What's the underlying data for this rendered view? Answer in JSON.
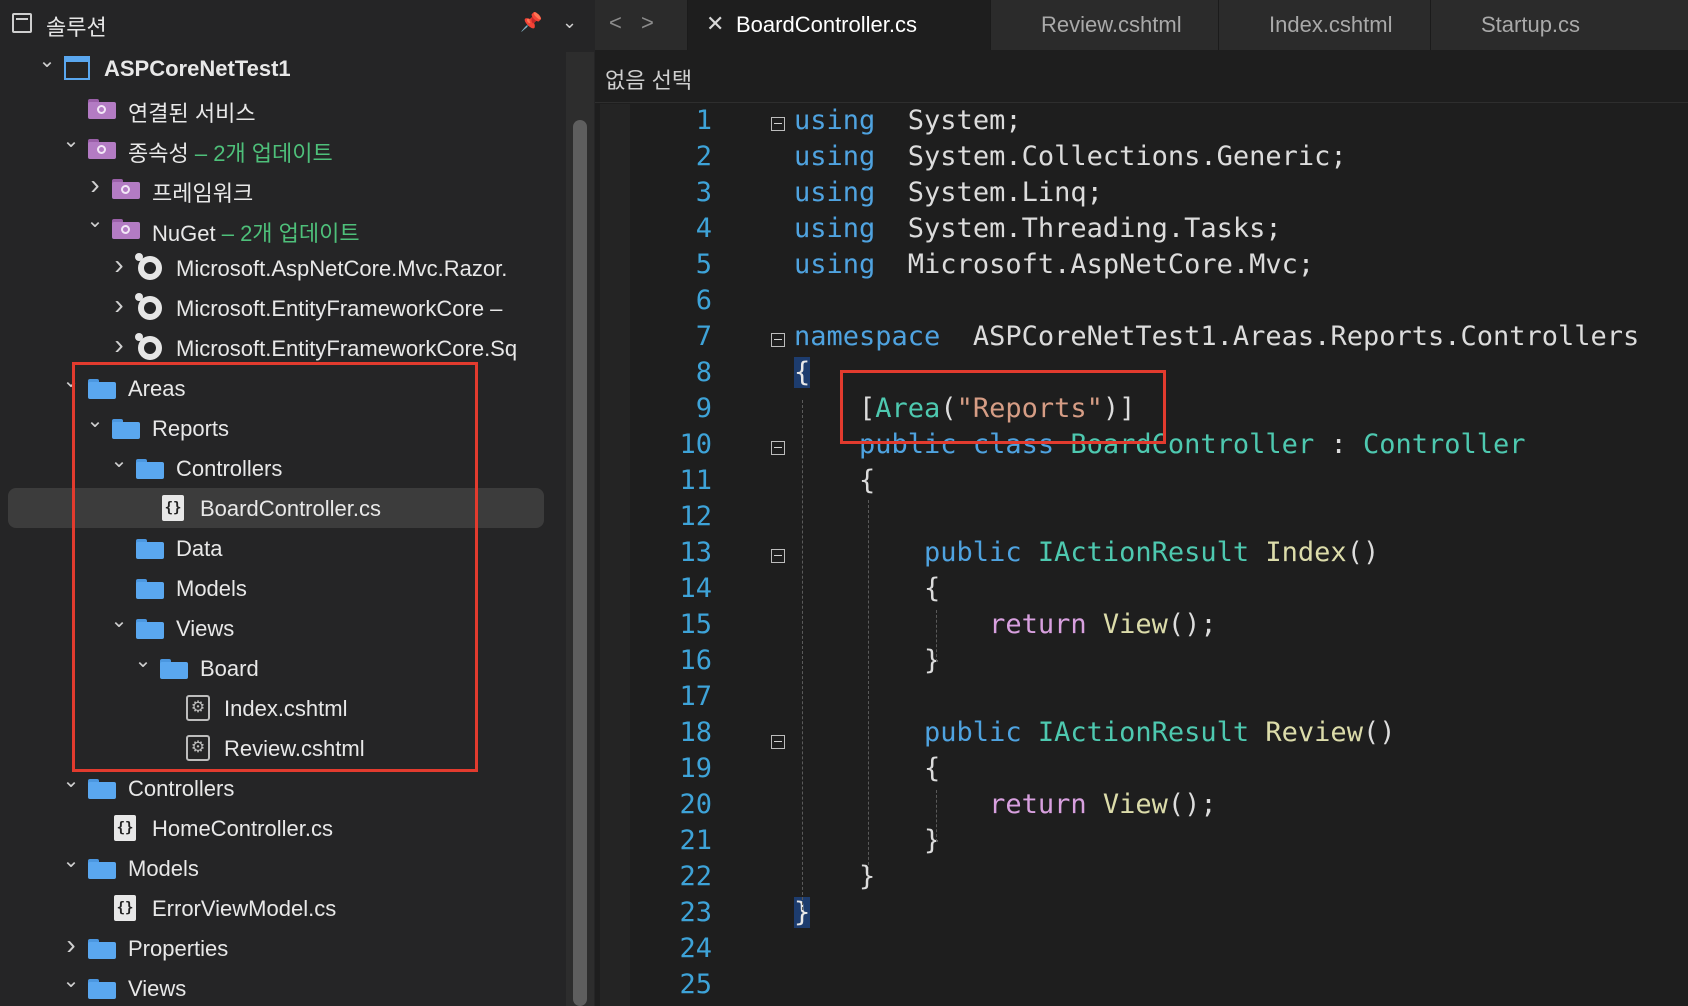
{
  "sidebar": {
    "title": "솔루션",
    "tree": [
      {
        "label": "ASPCoreNetTest1",
        "icon": "project-icon",
        "chevron": "down"
      },
      {
        "label": "연결된 서비스",
        "icon": "connected-services-icon",
        "chevron": ""
      },
      {
        "label": "종속성",
        "note": "– 2개 업데이트",
        "icon": "dependencies-icon",
        "chevron": "down"
      },
      {
        "label": "프레임워크",
        "icon": "framework-icon",
        "chevron": "right"
      },
      {
        "label": "NuGet",
        "note": "– 2개 업데이트",
        "icon": "nuget-icon",
        "chevron": "down"
      },
      {
        "label": "Microsoft.AspNetCore.Mvc.Razor.",
        "icon": "package-icon",
        "chevron": "right"
      },
      {
        "label": "Microsoft.EntityFrameworkCore  –",
        "icon": "package-icon",
        "chevron": "right"
      },
      {
        "label": "Microsoft.EntityFrameworkCore.Sq",
        "icon": "package-icon",
        "chevron": "right"
      },
      {
        "label": "Areas",
        "icon": "folder-icon",
        "chevron": "down"
      },
      {
        "label": "Reports",
        "icon": "folder-icon",
        "chevron": "down"
      },
      {
        "label": "Controllers",
        "icon": "folder-icon",
        "chevron": "down"
      },
      {
        "label": "BoardController.cs",
        "icon": "csharp-file-icon",
        "chevron": ""
      },
      {
        "label": "Data",
        "icon": "folder-icon",
        "chevron": ""
      },
      {
        "label": "Models",
        "icon": "folder-icon",
        "chevron": ""
      },
      {
        "label": "Views",
        "icon": "folder-icon",
        "chevron": "down"
      },
      {
        "label": "Board",
        "icon": "folder-icon",
        "chevron": "down"
      },
      {
        "label": "Index.cshtml",
        "icon": "razor-file-icon",
        "chevron": ""
      },
      {
        "label": "Review.cshtml",
        "icon": "razor-file-icon",
        "chevron": ""
      },
      {
        "label": "Controllers",
        "icon": "folder-icon",
        "chevron": "down"
      },
      {
        "label": "HomeController.cs",
        "icon": "csharp-file-icon",
        "chevron": ""
      },
      {
        "label": "Models",
        "icon": "folder-icon",
        "chevron": "down"
      },
      {
        "label": "ErrorViewModel.cs",
        "icon": "csharp-file-icon",
        "chevron": ""
      },
      {
        "label": "Properties",
        "icon": "folder-icon",
        "chevron": "right"
      },
      {
        "label": "Views",
        "icon": "folder-icon",
        "chevron": "down"
      }
    ],
    "selected_label": "BoardController.cs"
  },
  "tabs": [
    {
      "label": "BoardController.cs",
      "active": true
    },
    {
      "label": "Review.cshtml",
      "active": false
    },
    {
      "label": "Index.cshtml",
      "active": false
    },
    {
      "label": "Startup.cs",
      "active": false
    }
  ],
  "breadcrumb": "없음 선택",
  "editor": {
    "line_numbers": [
      "1",
      "2",
      "3",
      "4",
      "5",
      "6",
      "7",
      "8",
      "9",
      "10",
      "11",
      "12",
      "13",
      "14",
      "15",
      "16",
      "17",
      "18",
      "19",
      "20",
      "21",
      "22",
      "23",
      "24",
      "25"
    ],
    "lines": [
      [
        [
          "kw",
          "using"
        ],
        [
          "",
          "  System;"
        ]
      ],
      [
        [
          "kw",
          "using"
        ],
        [
          "",
          "  System.Collections.Generic;"
        ]
      ],
      [
        [
          "kw",
          "using"
        ],
        [
          "",
          "  System.Linq;"
        ]
      ],
      [
        [
          "kw",
          "using"
        ],
        [
          "",
          "  System.Threading.Tasks;"
        ]
      ],
      [
        [
          "kw",
          "using"
        ],
        [
          "",
          "  Microsoft.AspNetCore.Mvc;"
        ]
      ],
      [],
      [
        [
          "kw",
          "namespace"
        ],
        [
          "",
          "  ASPCoreNetTest1.Areas.Reports.Controllers"
        ]
      ],
      [
        [
          "hl",
          "{"
        ]
      ],
      [
        [
          "",
          "    ["
        ],
        [
          "type",
          "Area"
        ],
        [
          "",
          "("
        ],
        [
          "str",
          "\"Reports\""
        ],
        [
          "",
          ")]"
        ]
      ],
      [
        [
          "kw",
          "    public"
        ],
        [
          "",
          ""
        ],
        [
          "kw",
          " class"
        ],
        [
          "",
          ""
        ],
        [
          "type",
          " BoardController"
        ],
        [
          "",
          " : "
        ],
        [
          "type",
          "Controller"
        ]
      ],
      [
        [
          "",
          "    {"
        ]
      ],
      [],
      [
        [
          "kw",
          "        public"
        ],
        [
          "type",
          " IActionResult"
        ],
        [
          "fn",
          " Index"
        ],
        [
          "",
          "()"
        ]
      ],
      [
        [
          "",
          "        {"
        ]
      ],
      [
        [
          "ret",
          "            return"
        ],
        [
          "fn",
          " View"
        ],
        [
          "",
          "();"
        ]
      ],
      [
        [
          "",
          "        }"
        ]
      ],
      [],
      [
        [
          "kw",
          "        public"
        ],
        [
          "type",
          " IActionResult"
        ],
        [
          "fn",
          " Review"
        ],
        [
          "",
          "()"
        ]
      ],
      [
        [
          "",
          "        {"
        ]
      ],
      [
        [
          "ret",
          "            return"
        ],
        [
          "fn",
          " View"
        ],
        [
          "",
          "();"
        ]
      ],
      [
        [
          "",
          "        }"
        ]
      ],
      [
        [
          "",
          "    }"
        ]
      ],
      [
        [
          "hl",
          "}"
        ]
      ],
      [],
      []
    ]
  }
}
